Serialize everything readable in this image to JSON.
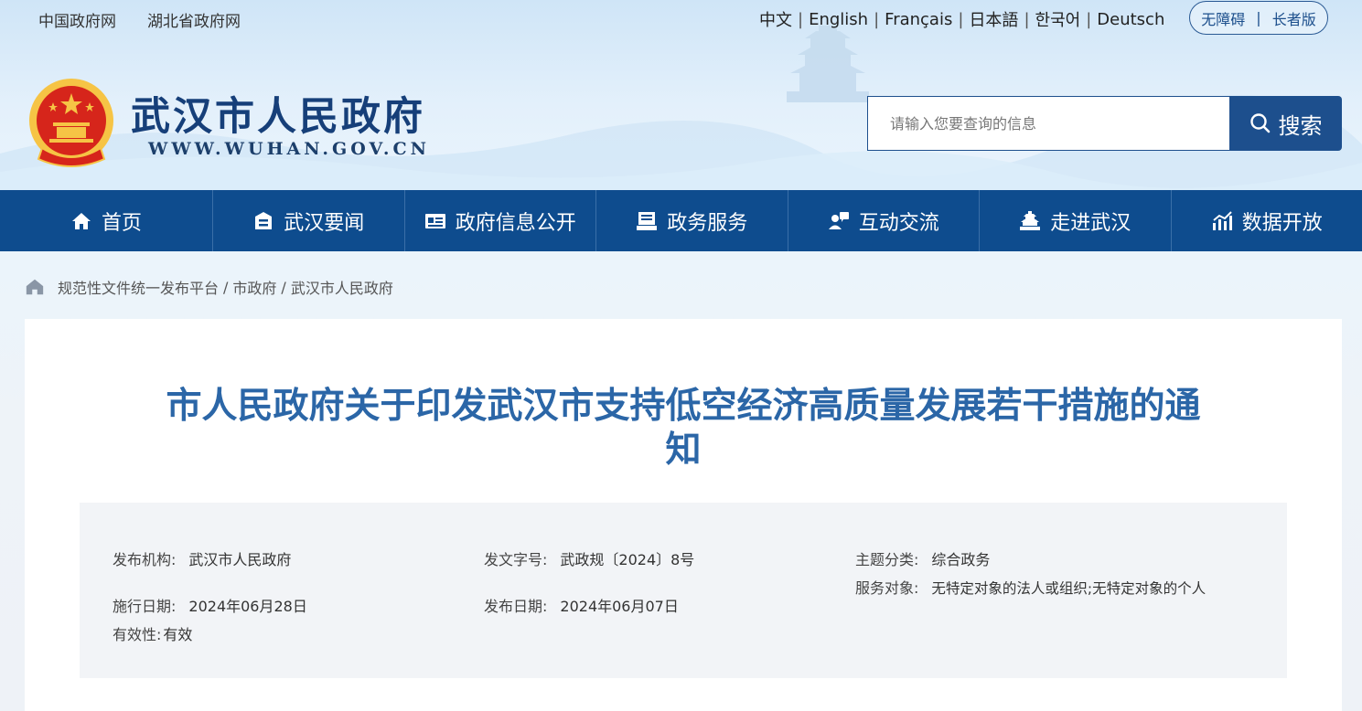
{
  "header": {
    "top_links": [
      "中国政府网",
      "湖北省政府网"
    ],
    "languages": [
      "中文",
      "English",
      "Français",
      "日本語",
      "한국어",
      "Deutsch"
    ],
    "accessibility": {
      "barrier_free": "无障碍",
      "elderly": "长者版"
    },
    "site_name": "武汉市人民政府",
    "site_url": "WWW.WUHAN.GOV.CN",
    "search": {
      "placeholder": "请输入您要查询的信息",
      "button": "搜索"
    }
  },
  "nav": {
    "items": [
      {
        "label": "首页",
        "icon": "home-icon"
      },
      {
        "label": "武汉要闻",
        "icon": "news-icon"
      },
      {
        "label": "政府信息公开",
        "icon": "info-icon"
      },
      {
        "label": "政务服务",
        "icon": "service-icon"
      },
      {
        "label": "互动交流",
        "icon": "interact-icon"
      },
      {
        "label": "走进武汉",
        "icon": "building-icon"
      },
      {
        "label": "数据开放",
        "icon": "chart-icon"
      }
    ]
  },
  "breadcrumb": [
    "规范性文件统一发布平台",
    "市政府",
    "武汉市人民政府"
  ],
  "document": {
    "title": "市人民政府关于印发武汉市支持低空经济高质量发展若干措施的通知",
    "meta": {
      "publisher_label": "发布机构:",
      "publisher": "武汉市人民政府",
      "doc_no_label": "发文字号:",
      "doc_no": "武政规〔2024〕8号",
      "topic_label": "主题分类:",
      "topic": "综合政务",
      "service_label": "服务对象:",
      "service": "无特定对象的法人或组织;无特定对象的个人",
      "effective_label": "施行日期:",
      "effective": "2024年06月28日",
      "issued_label": "发布日期:",
      "issued": "2024年06月07日",
      "validity_label": "有效性:",
      "validity": "有效"
    }
  },
  "colors": {
    "primary": "#0e4c8e",
    "title": "#2b66a7",
    "emblem_red": "#d6251b",
    "emblem_gold": "#f6c445"
  }
}
